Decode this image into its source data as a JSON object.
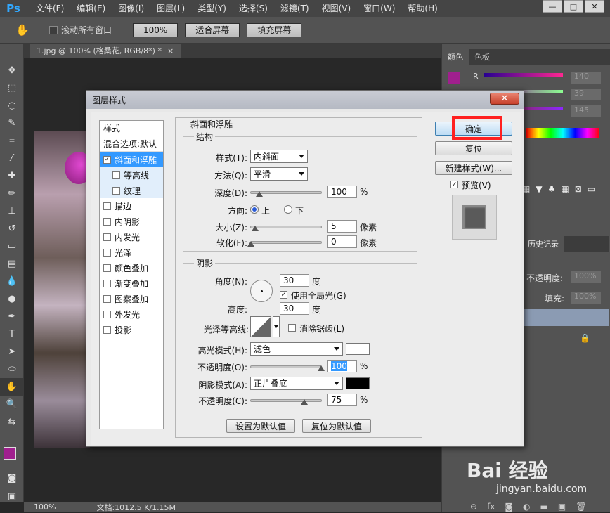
{
  "app": {
    "logo": "Ps"
  },
  "menu": [
    "文件(F)",
    "编辑(E)",
    "图像(I)",
    "图层(L)",
    "类型(Y)",
    "选择(S)",
    "滤镜(T)",
    "视图(V)",
    "窗口(W)",
    "帮助(H)"
  ],
  "window_buttons": [
    "—",
    "□",
    "✕"
  ],
  "options": {
    "scroll_all_windows": "滚动所有窗口",
    "zoom_100": "100%",
    "fit_screen": "适合屏幕",
    "fill_screen": "填充屏幕"
  },
  "document": {
    "tab": "1.jpg @ 100% (格桑花, RGB/8*) *",
    "tab_close": "×"
  },
  "status": {
    "zoom": "100%",
    "doc": "文档:1012.5 K/1.15M"
  },
  "right_panel": {
    "tabs": [
      "颜色",
      "色板"
    ],
    "r_label": "R",
    "values": [
      "140",
      "39",
      "145"
    ],
    "history_tab": "历史记录",
    "opacity_label": "不透明度:",
    "opacity_value": "100%",
    "fill_label": "填充:",
    "fill_value": "100%"
  },
  "dialog": {
    "title": "图层样式",
    "close": "✕",
    "style_header": "样式",
    "blend_options": "混合选项:默认",
    "styles": [
      {
        "label": "斜面和浮雕",
        "checked": true
      },
      {
        "label": "等高线",
        "checked": false
      },
      {
        "label": "纹理",
        "checked": false
      },
      {
        "label": "描边",
        "checked": false
      },
      {
        "label": "内阴影",
        "checked": false
      },
      {
        "label": "内发光",
        "checked": false
      },
      {
        "label": "光泽",
        "checked": false
      },
      {
        "label": "颜色叠加",
        "checked": false
      },
      {
        "label": "渐变叠加",
        "checked": false
      },
      {
        "label": "图案叠加",
        "checked": false
      },
      {
        "label": "外发光",
        "checked": false
      },
      {
        "label": "投影",
        "checked": false
      }
    ],
    "section_title": "斜面和浮雕",
    "structure": {
      "title": "结构",
      "style_label": "样式(T):",
      "style_value": "内斜面",
      "method_label": "方法(Q):",
      "method_value": "平滑",
      "depth_label": "深度(D):",
      "depth_value": "100",
      "depth_unit": "%",
      "direction_label": "方向:",
      "direction_up": "上",
      "direction_down": "下",
      "size_label": "大小(Z):",
      "size_value": "5",
      "size_unit": "像素",
      "soften_label": "软化(F):",
      "soften_value": "0",
      "soften_unit": "像素"
    },
    "shading": {
      "title": "阴影",
      "angle_label": "角度(N):",
      "angle_value": "30",
      "angle_unit": "度",
      "global_light": "使用全局光(G)",
      "altitude_label": "高度:",
      "altitude_value": "30",
      "altitude_unit": "度",
      "gloss_label": "光泽等高线:",
      "anti_alias": "消除锯齿(L)",
      "highlight_label": "高光模式(H):",
      "highlight_value": "滤色",
      "highlight_opacity_label": "不透明度(O):",
      "highlight_opacity_value": "100",
      "shadow_label": "阴影模式(A):",
      "shadow_value": "正片叠底",
      "shadow_opacity_label": "不透明度(C):",
      "shadow_opacity_value": "75",
      "percent": "%"
    },
    "make_default": "设置为默认值",
    "reset_default": "复位为默认值",
    "ok": "确定",
    "reset": "复位",
    "new_style": "新建样式(W)...",
    "preview": "预览(V)"
  },
  "watermark": {
    "brand": "Bai 经验",
    "url": "jingyan.baidu.com"
  },
  "colors": {
    "accent_fg": "#a0208e",
    "highlight_red": "#ff2020"
  }
}
